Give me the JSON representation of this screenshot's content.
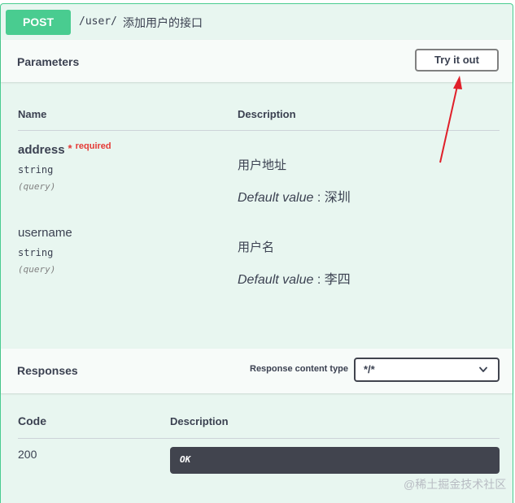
{
  "summary": {
    "method": "POST",
    "path": "/user/",
    "description": "添加用户的接口"
  },
  "parameters": {
    "title": "Parameters",
    "try_button": "Try it out",
    "col_name": "Name",
    "col_description": "Description",
    "items": [
      {
        "name": "address",
        "required_star": "*",
        "required": "required",
        "type": "string",
        "in": "(query)",
        "description": "用户地址",
        "default_label": "Default value",
        "default_sep": " : ",
        "default_value": "深圳"
      },
      {
        "name": "username",
        "type": "string",
        "in": "(query)",
        "description": "用户名",
        "default_label": "Default value",
        "default_sep": " : ",
        "default_value": "李四"
      }
    ]
  },
  "responses": {
    "title": "Responses",
    "content_type_label": "Response content type",
    "content_type_value": "*/*",
    "col_code": "Code",
    "col_description": "Description",
    "rows": [
      {
        "code": "200",
        "description": "OK"
      }
    ]
  },
  "watermark": "@稀土掘金技术社区",
  "colors": {
    "post_green": "#49cc90",
    "block_bg": "#e8f6f0",
    "annotation_arrow": "#e0202a"
  },
  "icons": {
    "select_chevron": "chevron-down-icon",
    "annotation": "red-arrow-annotation"
  }
}
